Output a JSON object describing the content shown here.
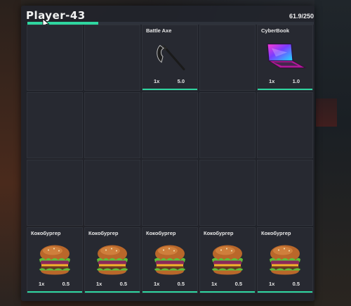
{
  "player": {
    "name": "Player-43",
    "weight_text": "61.9/250",
    "weight_fraction": 0.2476
  },
  "colors": {
    "accent": "#2fd6a0",
    "slot_bg": "#272931",
    "panel_bg": "#22242b"
  },
  "slots": [
    {
      "name": "",
      "qty": "",
      "weight": ""
    },
    {
      "name": "",
      "qty": "",
      "weight": ""
    },
    {
      "name": "Battle Axe",
      "qty": "1x",
      "weight": "5.0",
      "icon": "battle-axe-icon"
    },
    {
      "name": "",
      "qty": "",
      "weight": ""
    },
    {
      "name": "CyberBook",
      "qty": "1x",
      "weight": "1.0",
      "icon": "laptop-icon"
    },
    {
      "name": "",
      "qty": "",
      "weight": ""
    },
    {
      "name": "",
      "qty": "",
      "weight": ""
    },
    {
      "name": "",
      "qty": "",
      "weight": ""
    },
    {
      "name": "",
      "qty": "",
      "weight": ""
    },
    {
      "name": "",
      "qty": "",
      "weight": ""
    },
    {
      "name": "",
      "qty": "",
      "weight": ""
    },
    {
      "name": "",
      "qty": "",
      "weight": ""
    },
    {
      "name": "",
      "qty": "",
      "weight": ""
    },
    {
      "name": "",
      "qty": "",
      "weight": ""
    },
    {
      "name": "",
      "qty": "",
      "weight": ""
    },
    {
      "name": "Кокобургер",
      "qty": "1x",
      "weight": "0.5",
      "icon": "burger-icon"
    },
    {
      "name": "Кокобургер",
      "qty": "1x",
      "weight": "0.5",
      "icon": "burger-icon"
    },
    {
      "name": "Кокобургер",
      "qty": "1x",
      "weight": "0.5",
      "icon": "burger-icon"
    },
    {
      "name": "Кокобургер",
      "qty": "1x",
      "weight": "0.5",
      "icon": "burger-icon"
    },
    {
      "name": "Кокобургер",
      "qty": "1x",
      "weight": "0.5",
      "icon": "burger-icon"
    }
  ]
}
